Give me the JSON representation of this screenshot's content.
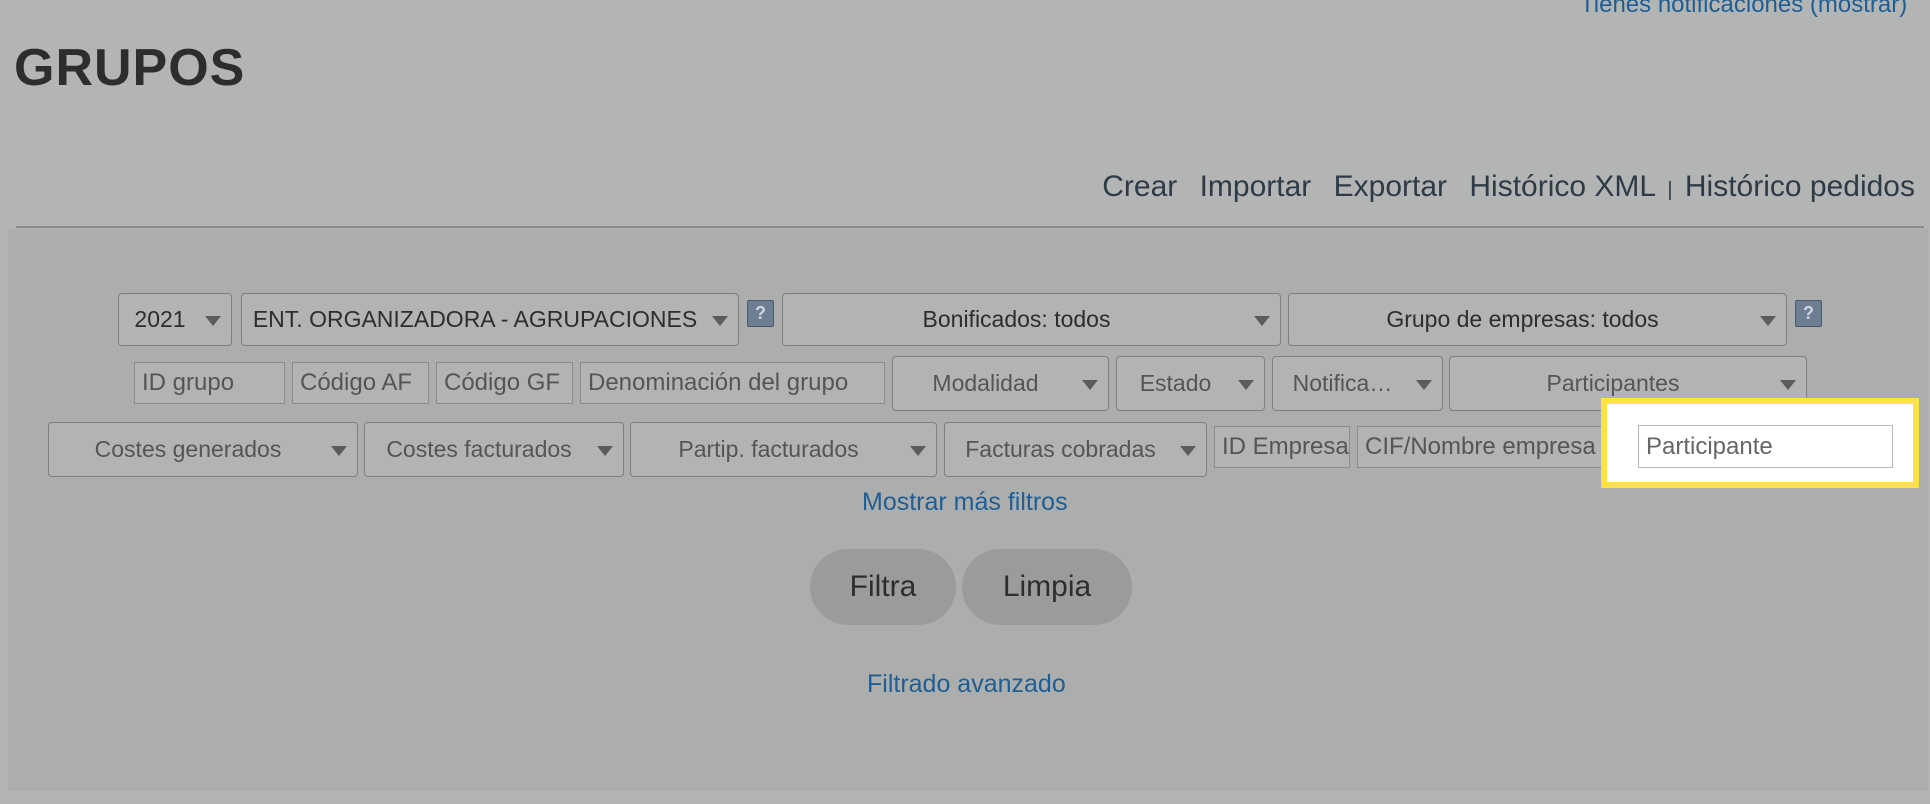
{
  "header": {
    "notifications_link": "Tienes notificaciones (mostrar)",
    "title": "GRUPOS"
  },
  "actions": {
    "create": "Crear",
    "import": "Importar",
    "export": "Exportar",
    "xml_history": "Histórico XML",
    "separator": "|",
    "orders_history": "Histórico pedidos"
  },
  "filters": {
    "year": "2021",
    "entity": "ENT. ORGANIZADORA - AGRUPACIONES",
    "help_symbol": "?",
    "bonificados": "Bonificados: todos",
    "company_group": "Grupo de empresas: todos",
    "id_group_placeholder": "ID grupo",
    "codigo_af_placeholder": "Código AF",
    "codigo_gf_placeholder": "Código GF",
    "denominacion_placeholder": "Denominación del grupo",
    "modalidad": "Modalidad",
    "estado": "Estado",
    "notificaciones": "Notifica…",
    "participantes": "Participantes",
    "costes_generados": "Costes generados",
    "costes_facturados": "Costes facturados",
    "partip_facturados": "Partip. facturados",
    "facturas_cobradas": "Facturas cobradas",
    "id_empresa_placeholder": "ID Empresa",
    "cif_placeholder": "CIF/Nombre empresa",
    "participante_placeholder": "Participante"
  },
  "links": {
    "more_filters": "Mostrar más filtros",
    "advanced_filter": "Filtrado avanzado"
  },
  "buttons": {
    "filter": "Filtra",
    "clear": "Limpia"
  },
  "colors": {
    "highlight": "#ffe245",
    "link": "#1f5e94"
  }
}
